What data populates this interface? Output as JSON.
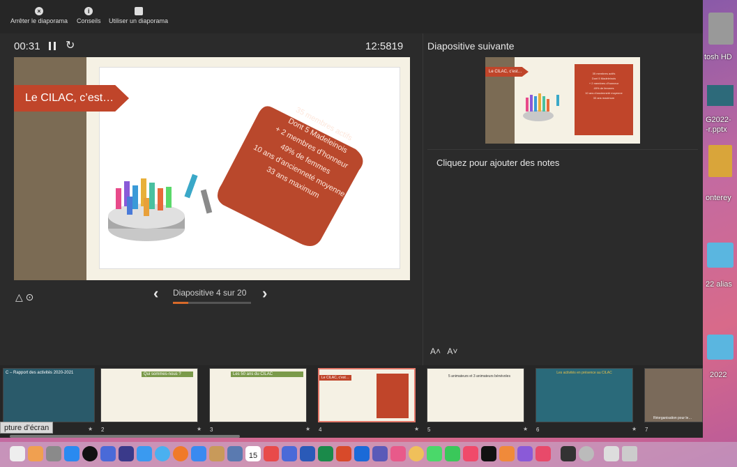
{
  "toolbar": {
    "stop_label": "Arrêter le diaporama",
    "tips_label": "Conseils",
    "use_label": "Utiliser un diaporama"
  },
  "timer": {
    "elapsed": "00:31",
    "clock": "12:5819"
  },
  "current_slide": {
    "ribbon": "Le CILAC, c’est…",
    "lines": [
      "35 membres actifs",
      "Dont 5 Madeleinois",
      "+ 2 membres d’honneur",
      "49% de femmes",
      "10 ans d’ancienneté moyenne",
      "33 ans maximum"
    ]
  },
  "navigation": {
    "label": "Diapositive 4 sur 20",
    "progress": 0.2
  },
  "next_slide": {
    "title": "Diapositive suivante",
    "ribbon": "Le CILAC, c’est…",
    "lines": [
      "35 membres actifs",
      "Dont 5 Madeleinois",
      "+ 2 membres d’honneur",
      "49% de femmes",
      "10 ans d’ancienneté moyenne",
      "33 ans maximum"
    ]
  },
  "notes": {
    "placeholder": "Cliquez pour ajouter des notes"
  },
  "thumbnails": [
    {
      "num": "1",
      "title": "C – Rapport des activités 2020-2021"
    },
    {
      "num": "2",
      "title": "Qui sommes-nous ?"
    },
    {
      "num": "3",
      "title": "Les 50 ans du CILAC"
    },
    {
      "num": "4",
      "title": "Le CILAC, c’est…"
    },
    {
      "num": "5",
      "title": "5 animateurs et 3 animateurs bénévoles"
    },
    {
      "num": "6",
      "title": "Les activités en présence au CILAC"
    },
    {
      "num": "7",
      "title": "Réorganisation pour le…"
    }
  ],
  "tooltip": "pture d’écran",
  "desktop": {
    "disk": "tosh HD",
    "file1": "G2022-",
    "file1b": "-r.pptx",
    "file2": "onterey",
    "alias": "22 alias",
    "year": "2022"
  },
  "dock": {
    "calendar_day": "15"
  },
  "colors": {
    "accent": "#c0452a",
    "sidebar": "#7b6b54",
    "progress": "#d86a2a",
    "selected_border": "#e5796a"
  }
}
